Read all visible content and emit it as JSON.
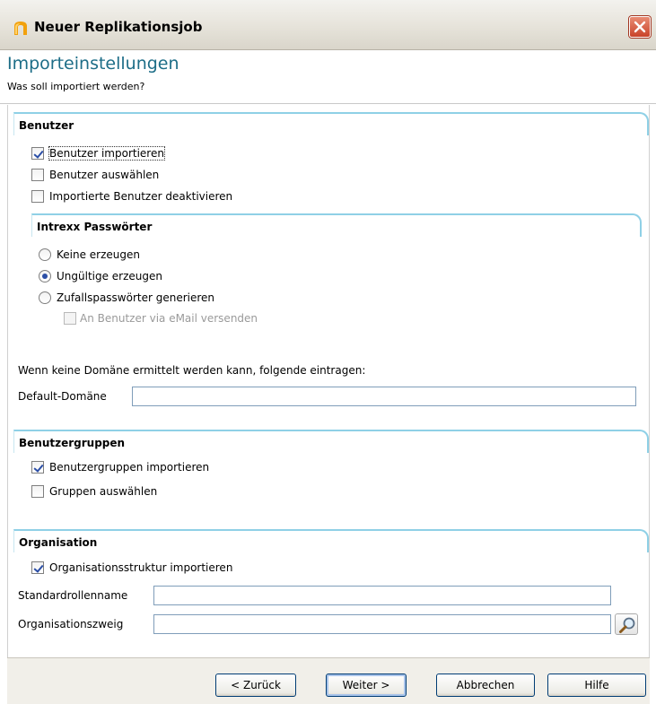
{
  "window": {
    "title": "Neuer Replikationsjob"
  },
  "header": {
    "title": "Importeinstellungen",
    "subtitle": "Was soll importiert werden?"
  },
  "benutzer": {
    "heading": "Benutzer",
    "import_users": {
      "label": "Benutzer importieren",
      "checked": true
    },
    "select_users": {
      "label": "Benutzer auswählen",
      "checked": false
    },
    "deactivate_users": {
      "label": "Importierte Benutzer deaktivieren",
      "checked": false
    },
    "passwords": {
      "heading": "Intrexx Passwörter",
      "options": [
        "Keine erzeugen",
        "Ungültige erzeugen",
        "Zufallspasswörter generieren"
      ],
      "selected": "Ungültige erzeugen",
      "send_mail": {
        "label": "An Benutzer via eMail versenden",
        "checked": false,
        "enabled": false
      }
    },
    "domain_hint": "Wenn keine Domäne ermittelt werden kann, folgende eintragen:",
    "default_domain": {
      "label": "Default-Domäne",
      "value": ""
    }
  },
  "benutzergruppen": {
    "heading": "Benutzergruppen",
    "import_groups": {
      "label": "Benutzergruppen importieren",
      "checked": true
    },
    "select_groups": {
      "label": "Gruppen auswählen",
      "checked": false
    }
  },
  "organisation": {
    "heading": "Organisation",
    "import_structure": {
      "label": "Organisationsstruktur importieren",
      "checked": true
    },
    "role_name": {
      "label": "Standardrollenname",
      "value": ""
    },
    "branch": {
      "label": "Organisationszweig",
      "value": ""
    }
  },
  "footer": {
    "back": "< Zurück",
    "next": "Weiter >",
    "cancel": "Abbrechen",
    "help": "Hilfe"
  },
  "icons": {
    "app": "intrexx-logo-icon",
    "close": "close-icon",
    "search": "magnifier-icon"
  },
  "colors": {
    "accent": "#1d6d87",
    "group_border": "#8fd0e6",
    "close": "#c9432a"
  }
}
